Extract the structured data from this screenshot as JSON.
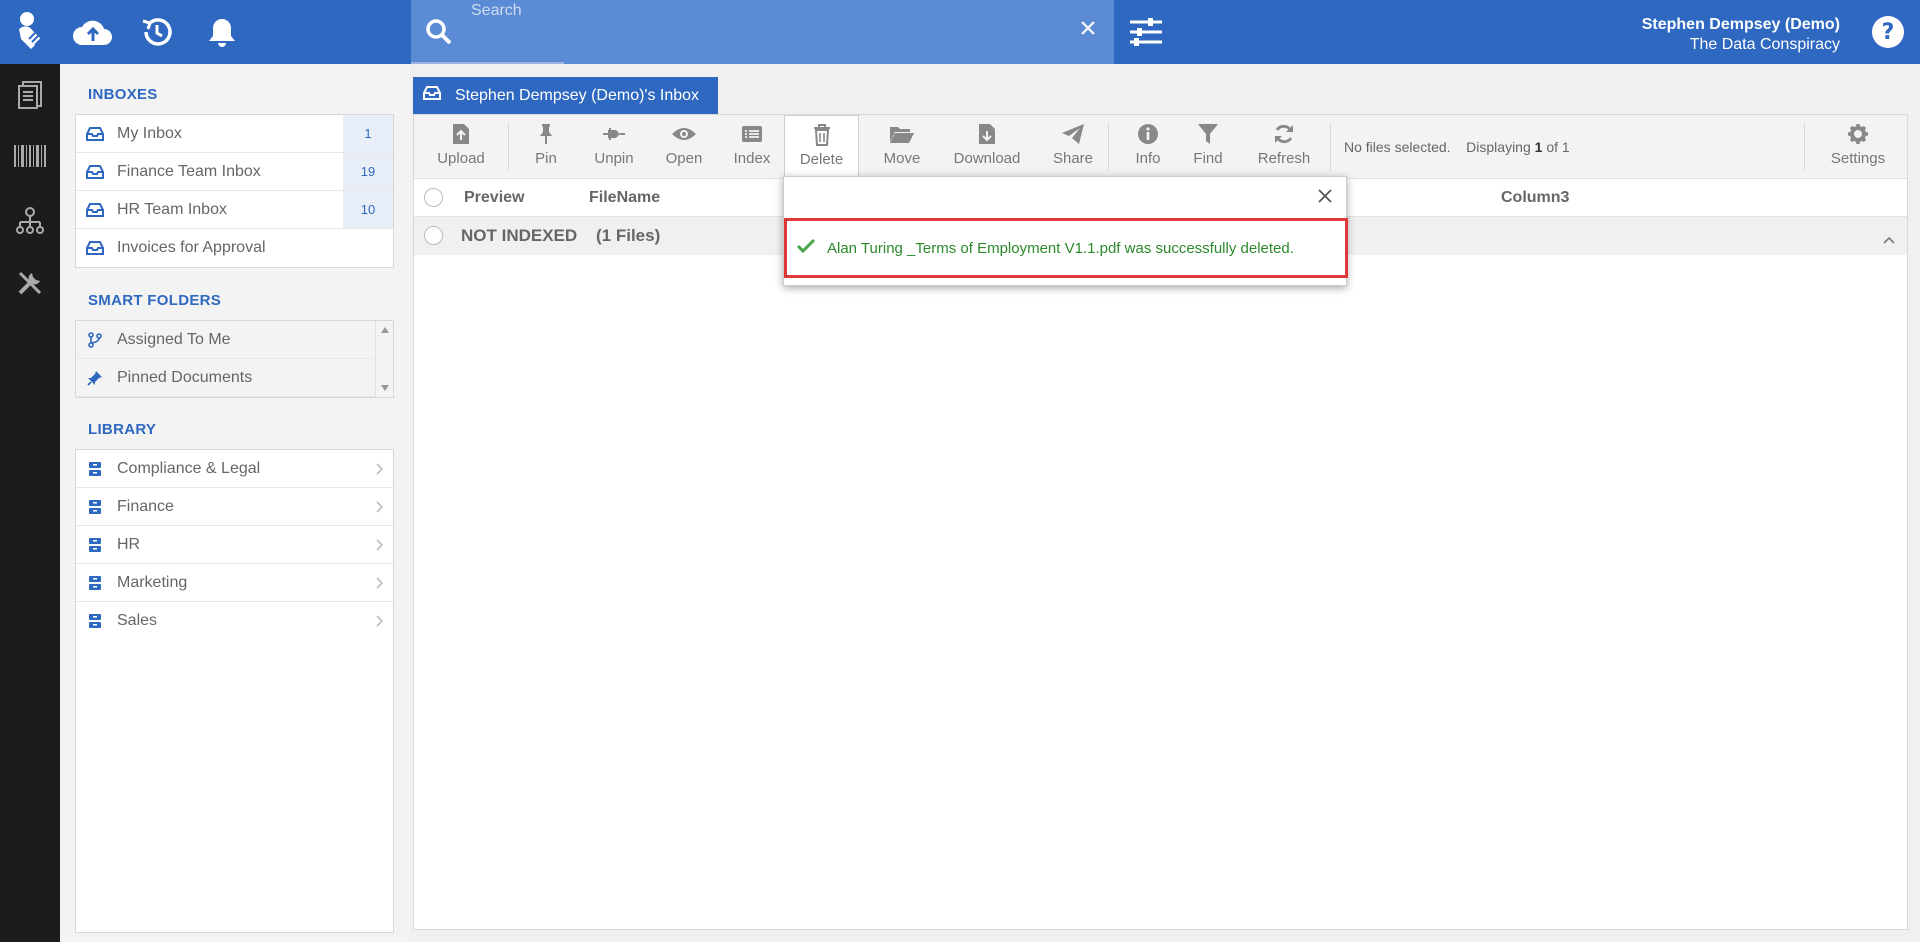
{
  "header": {
    "search_placeholder": "Search",
    "user_name": "Stephen Dempsey (Demo)",
    "organization": "The Data Conspiracy"
  },
  "sidebar": {
    "inboxes_title": "INBOXES",
    "inboxes": [
      {
        "label": "My Inbox",
        "count": "1"
      },
      {
        "label": "Finance Team Inbox",
        "count": "19"
      },
      {
        "label": "HR Team Inbox",
        "count": "10"
      },
      {
        "label": "Invoices for Approval",
        "count": ""
      }
    ],
    "smart_title": "SMART FOLDERS",
    "smart_folders": [
      {
        "label": "Assigned To Me"
      },
      {
        "label": "Pinned Documents"
      }
    ],
    "library_title": "LIBRARY",
    "library": [
      {
        "label": "Compliance & Legal"
      },
      {
        "label": "Finance"
      },
      {
        "label": "HR"
      },
      {
        "label": "Marketing"
      },
      {
        "label": "Sales"
      }
    ]
  },
  "main": {
    "tab_label": "Stephen Dempsey (Demo)'s Inbox",
    "toolbar": {
      "upload": "Upload",
      "pin": "Pin",
      "unpin": "Unpin",
      "open": "Open",
      "index": "Index",
      "delete": "Delete",
      "move": "Move",
      "download": "Download",
      "share": "Share",
      "info": "Info",
      "find": "Find",
      "refresh": "Refresh",
      "settings": "Settings"
    },
    "status_selected": "No files selected.",
    "status_display_prefix": "Displaying",
    "status_display_current": "1",
    "status_display_suffix": "of 1",
    "columns": {
      "preview": "Preview",
      "filename": "FileName",
      "column3": "Column3"
    },
    "group": {
      "name": "NOT INDEXED",
      "count": "(1 Files)"
    }
  },
  "notification": {
    "message": "Alan Turing _Terms of Employment V1.1.pdf was successfully deleted.",
    "success_color": "#2b8a2b",
    "highlight_color": "#e03838"
  },
  "colors": {
    "brand": "#2e68c0",
    "rail": "#1c1c1c"
  }
}
